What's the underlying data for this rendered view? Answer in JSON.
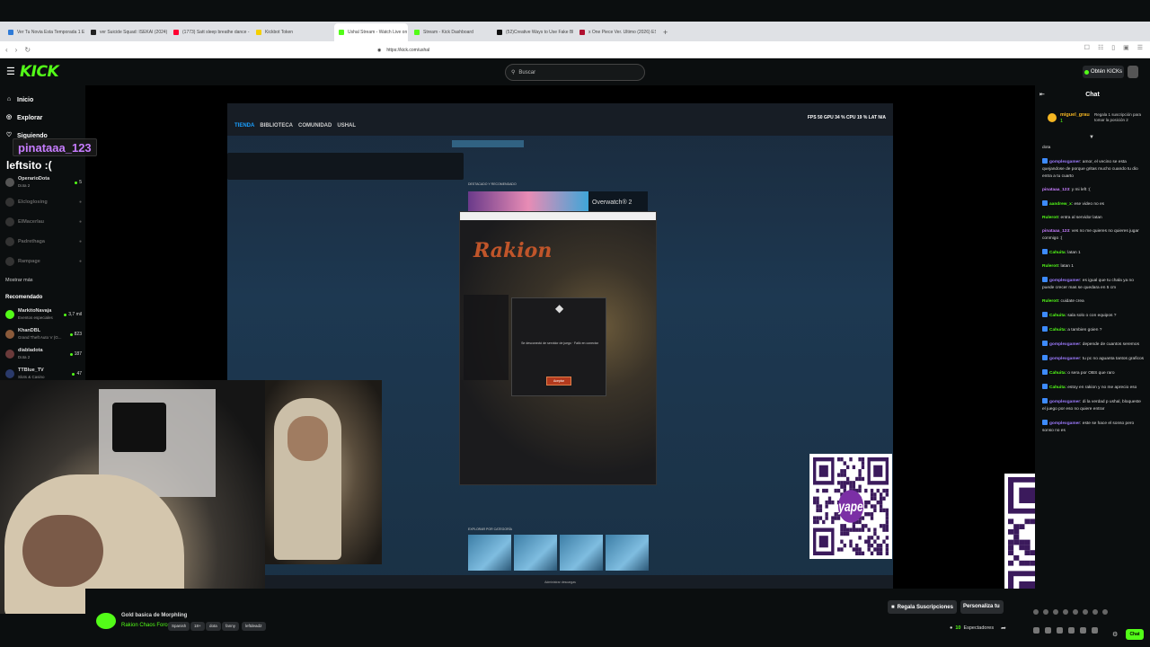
{
  "browser": {
    "tabs": [
      {
        "label": "Ver Tu Novia Esta Temporada 1 E...",
        "favicon_color": "#2f7bd7",
        "active": false
      },
      {
        "label": "ver Suicide Squad: ISEKAI (2024) Onl...",
        "favicon_color": "#222222",
        "active": false
      },
      {
        "label": "(1773) Satt sleep breathe dance - Yo...",
        "favicon_color": "#ff0033",
        "active": false
      },
      {
        "label": "Kickbot Token",
        "favicon_color": "#f5d000",
        "active": false
      },
      {
        "label": "Ushal Stream - Watch Live on K...",
        "favicon_color": "#53fc18",
        "active": true
      },
      {
        "label": "Stream - Kick Dashboard",
        "favicon_color": "#53fc18",
        "active": false
      },
      {
        "label": "(52)Creative Ways to Use Fake Blood",
        "favicon_color": "#111111",
        "active": false
      },
      {
        "label": "x One Piece Ver. Ultimo (2026) ESPAÑ...",
        "favicon_color": "#b01030",
        "active": false
      }
    ],
    "new_tab": "+",
    "url": "https://kick.com/ushal"
  },
  "header": {
    "logo": "KICK",
    "search_placeholder": "Buscar",
    "kicks_button": "Obtén KICKs"
  },
  "sidebar": {
    "nav": [
      {
        "label": "Inicio",
        "icon": "home-icon"
      },
      {
        "label": "Explorar",
        "icon": "compass-icon"
      },
      {
        "label": "Siguiendo",
        "icon": "heart-icon"
      }
    ],
    "following": [
      {
        "name": "OperarioDota",
        "game": "Dota 2",
        "viewers": "5",
        "live": true
      },
      {
        "name": "Elcloglosing",
        "game": "",
        "viewers": "",
        "live": false
      },
      {
        "name": "ElMacerlau",
        "game": "",
        "viewers": "",
        "live": false
      },
      {
        "name": "Padrethaga",
        "game": "",
        "viewers": "",
        "live": false
      },
      {
        "name": "Rampage",
        "game": "",
        "viewers": "",
        "live": false
      }
    ],
    "show_more": "Mostrar más",
    "recommended_title": "Recomendado",
    "recommended": [
      {
        "name": "MarkitoNavaja",
        "game": "Eventos especiales",
        "viewers": "3,7 mil"
      },
      {
        "name": "KhanDBL",
        "game": "Grand Theft Auto V (G...",
        "viewers": "823"
      },
      {
        "name": "diabladota",
        "game": "Dota 2",
        "viewers": "187"
      },
      {
        "name": "TTBlue_TV",
        "game": "Slots & Casino",
        "viewers": "47"
      }
    ]
  },
  "overlay": {
    "username": "pinataaa_123",
    "message": "leftsito :("
  },
  "game": {
    "steam_nav": [
      "TIENDA",
      "BIBLIOTECA",
      "COMUNIDAD",
      "USHAL"
    ],
    "fps_text": "FPS 50 GPU 34 % CPU 19 % LAT N/A",
    "featured_label": "DESTACADO Y RECOMENDADO",
    "featured_game": "Overwatch® 2",
    "dialog_message": "Se desconectó de servidor de juego · Falló en conectar",
    "dialog_ok": "Aceptar",
    "explore_label": "EXPLORAR POR CATEGORÍA",
    "bottom_text": "Administrar descargas"
  },
  "stream": {
    "title": "Gold basica de  Morphling",
    "category": "Rakion Chaos Force",
    "tags": [
      "Spanish",
      "18+",
      "dota",
      "fanny",
      "leftdead2"
    ],
    "viewers_count": "10",
    "viewers_label": "Espectadores",
    "gift_sub_button": "Regala Suscripciones",
    "customize_button": "Personaliza tu"
  },
  "chat": {
    "title": "Chat",
    "pinned": {
      "user": "miguel_grau",
      "kicks": "1",
      "text": "Regala 1 suscripción para tomar la posición 2"
    },
    "messages": [
      {
        "user": "",
        "text": "dota",
        "color": "#dddddd",
        "badge": false
      },
      {
        "user": "gomplexgamer",
        "text": ": amor, el vecino se esta quejandose de porque gritas mucho cuando tu dio entra a tu cuarto",
        "color": "#9e7bff",
        "badge": true
      },
      {
        "user": "pinataaa_123",
        "text": ": y mi left :(",
        "color": "#c77dff",
        "badge": false
      },
      {
        "user": "aandrew_x",
        "text": ": ese video no es",
        "color": "#53fc18",
        "badge": true
      },
      {
        "user": "Rulero0",
        "text": ": entra al servidor latan",
        "color": "#53fc18",
        "badge": false
      },
      {
        "user": "pinataaa_123",
        "text": ": ves no me quieres no quieres jugar conmigo :(",
        "color": "#c77dff",
        "badge": false
      },
      {
        "user": "Cahuita",
        "text": ": latan 1",
        "color": "#53fc18",
        "badge": true
      },
      {
        "user": "Rulero0",
        "text": ": latan 1",
        "color": "#53fc18",
        "badge": false
      },
      {
        "user": "gomplexgamer",
        "text": ": es igual que tu chala ya no puede crecer mas se quedara en 5 cm",
        "color": "#9e7bff",
        "badge": true
      },
      {
        "user": "Rulero0",
        "text": ": cuidate crea",
        "color": "#53fc18",
        "badge": false
      },
      {
        "user": "Cahuita",
        "text": ": sala solo o con equipos ?",
        "color": "#53fc18",
        "badge": true
      },
      {
        "user": "Cahuita",
        "text": ": a tambien goien ?",
        "color": "#53fc18",
        "badge": true
      },
      {
        "user": "gomplexgamer",
        "text": ": depende de cuantos seremos",
        "color": "#9e7bff",
        "badge": true
      },
      {
        "user": "gomplexgamer",
        "text": ": tu pc no aguanta tantos graficos",
        "color": "#9e7bff",
        "badge": true
      },
      {
        "user": "Cahuita",
        "text": ": o sera por OBS que raro",
        "color": "#53fc18",
        "badge": true
      },
      {
        "user": "Cahuita",
        "text": ": estoy en rakion y no me aprecio eso",
        "color": "#53fc18",
        "badge": true
      },
      {
        "user": "gomplexgamer",
        "text": ": di la verdad p ushal, bloqueste el juego por eso no quiere entrar",
        "color": "#9e7bff",
        "badge": true
      },
      {
        "user": "gomplexgamer",
        "text": ": este se hace el sonso pero sonso no es",
        "color": "#9e7bff",
        "badge": true
      }
    ],
    "chat_button": "Chat"
  },
  "qr_label": "yape"
}
